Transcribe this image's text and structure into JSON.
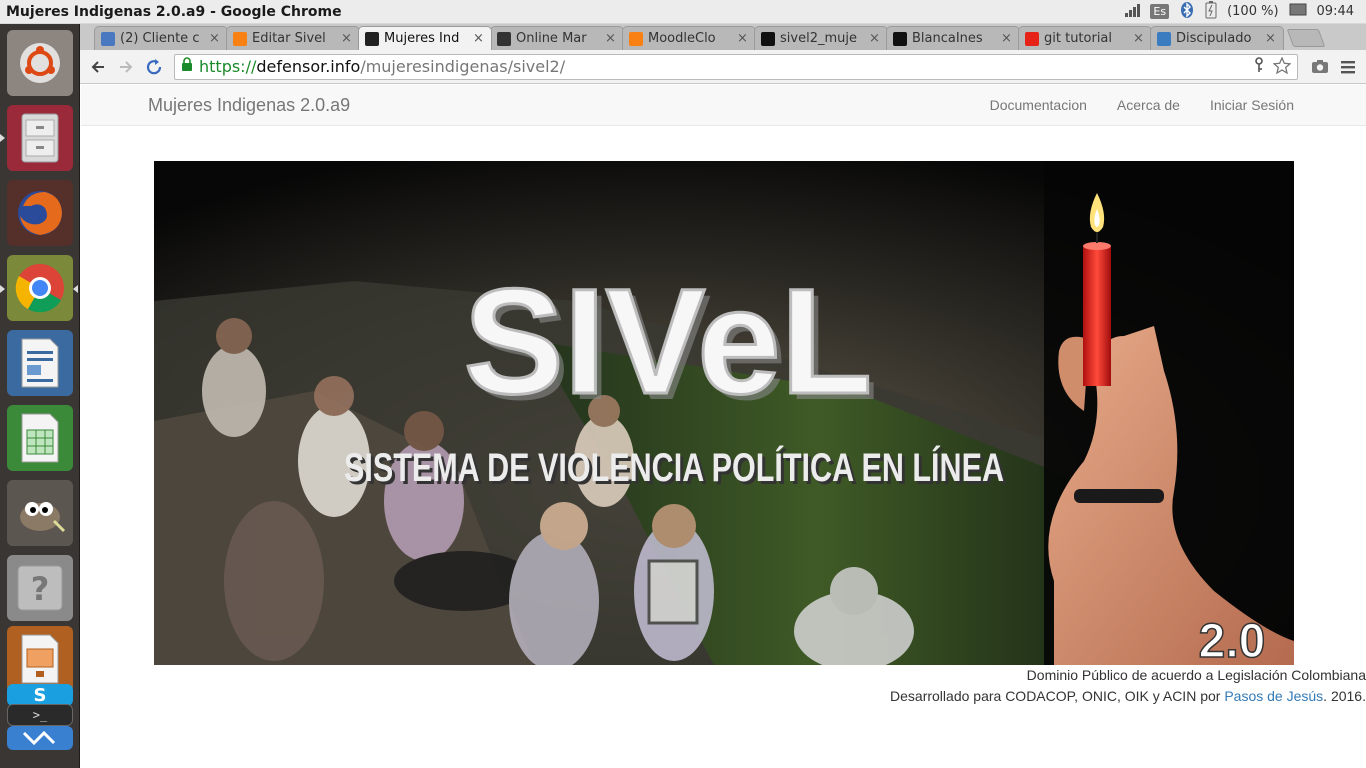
{
  "window": {
    "title": "Mujeres Indigenas 2.0.a9 - Google Chrome"
  },
  "tray": {
    "keyboard": "Es",
    "battery": "(100 %)",
    "clock": "09:44"
  },
  "tabs": [
    {
      "label": "(2) Cliente c",
      "favicon_color": "#4a78c0",
      "active": false
    },
    {
      "label": "Editar Sivel",
      "favicon_color": "#f98012",
      "active": false
    },
    {
      "label": "Mujeres Ind",
      "favicon_color": "#222222",
      "active": true
    },
    {
      "label": "Online Mar",
      "favicon_color": "#333333",
      "active": false
    },
    {
      "label": "MoodleClo",
      "favicon_color": "#f98012",
      "active": false
    },
    {
      "label": "sivel2_muje",
      "favicon_color": "#111111",
      "active": false
    },
    {
      "label": "BlancaInes",
      "favicon_color": "#111111",
      "active": false
    },
    {
      "label": "git tutorial",
      "favicon_color": "#e62117",
      "active": false
    },
    {
      "label": "Discipulado",
      "favicon_color": "#3b7bbf",
      "active": false
    }
  ],
  "tab_close_glyph": "×",
  "address": {
    "scheme": "https://",
    "host": "defensor.info",
    "path": "/mujeresindigenas/sivel2/"
  },
  "site": {
    "brand": "Mujeres Indigenas 2.0.a9",
    "nav": [
      "Documentacion",
      "Acerca de",
      "Iniciar Sesión"
    ]
  },
  "banner": {
    "logo": "SIVeL",
    "subtitle": "SISTEMA DE VIOLENCIA POLÍTICA EN LÍNEA",
    "version": "2.0"
  },
  "footer": {
    "line1": "Dominio Público de acuerdo a Legislación Colombiana",
    "line2_prefix": "Desarrollado para CODACOP, ONIC, OIK y ACIN por ",
    "link": "Pasos de Jesús",
    "line2_suffix": ". 2016."
  },
  "launcher_icons": [
    "ubuntu-dash-icon",
    "files-icon",
    "firefox-icon",
    "chrome-icon",
    "writer-icon",
    "calc-icon",
    "gimp-icon",
    "help-icon",
    "impress-icon",
    "skype-icon",
    "terminal-icon",
    "vscode-icon"
  ]
}
